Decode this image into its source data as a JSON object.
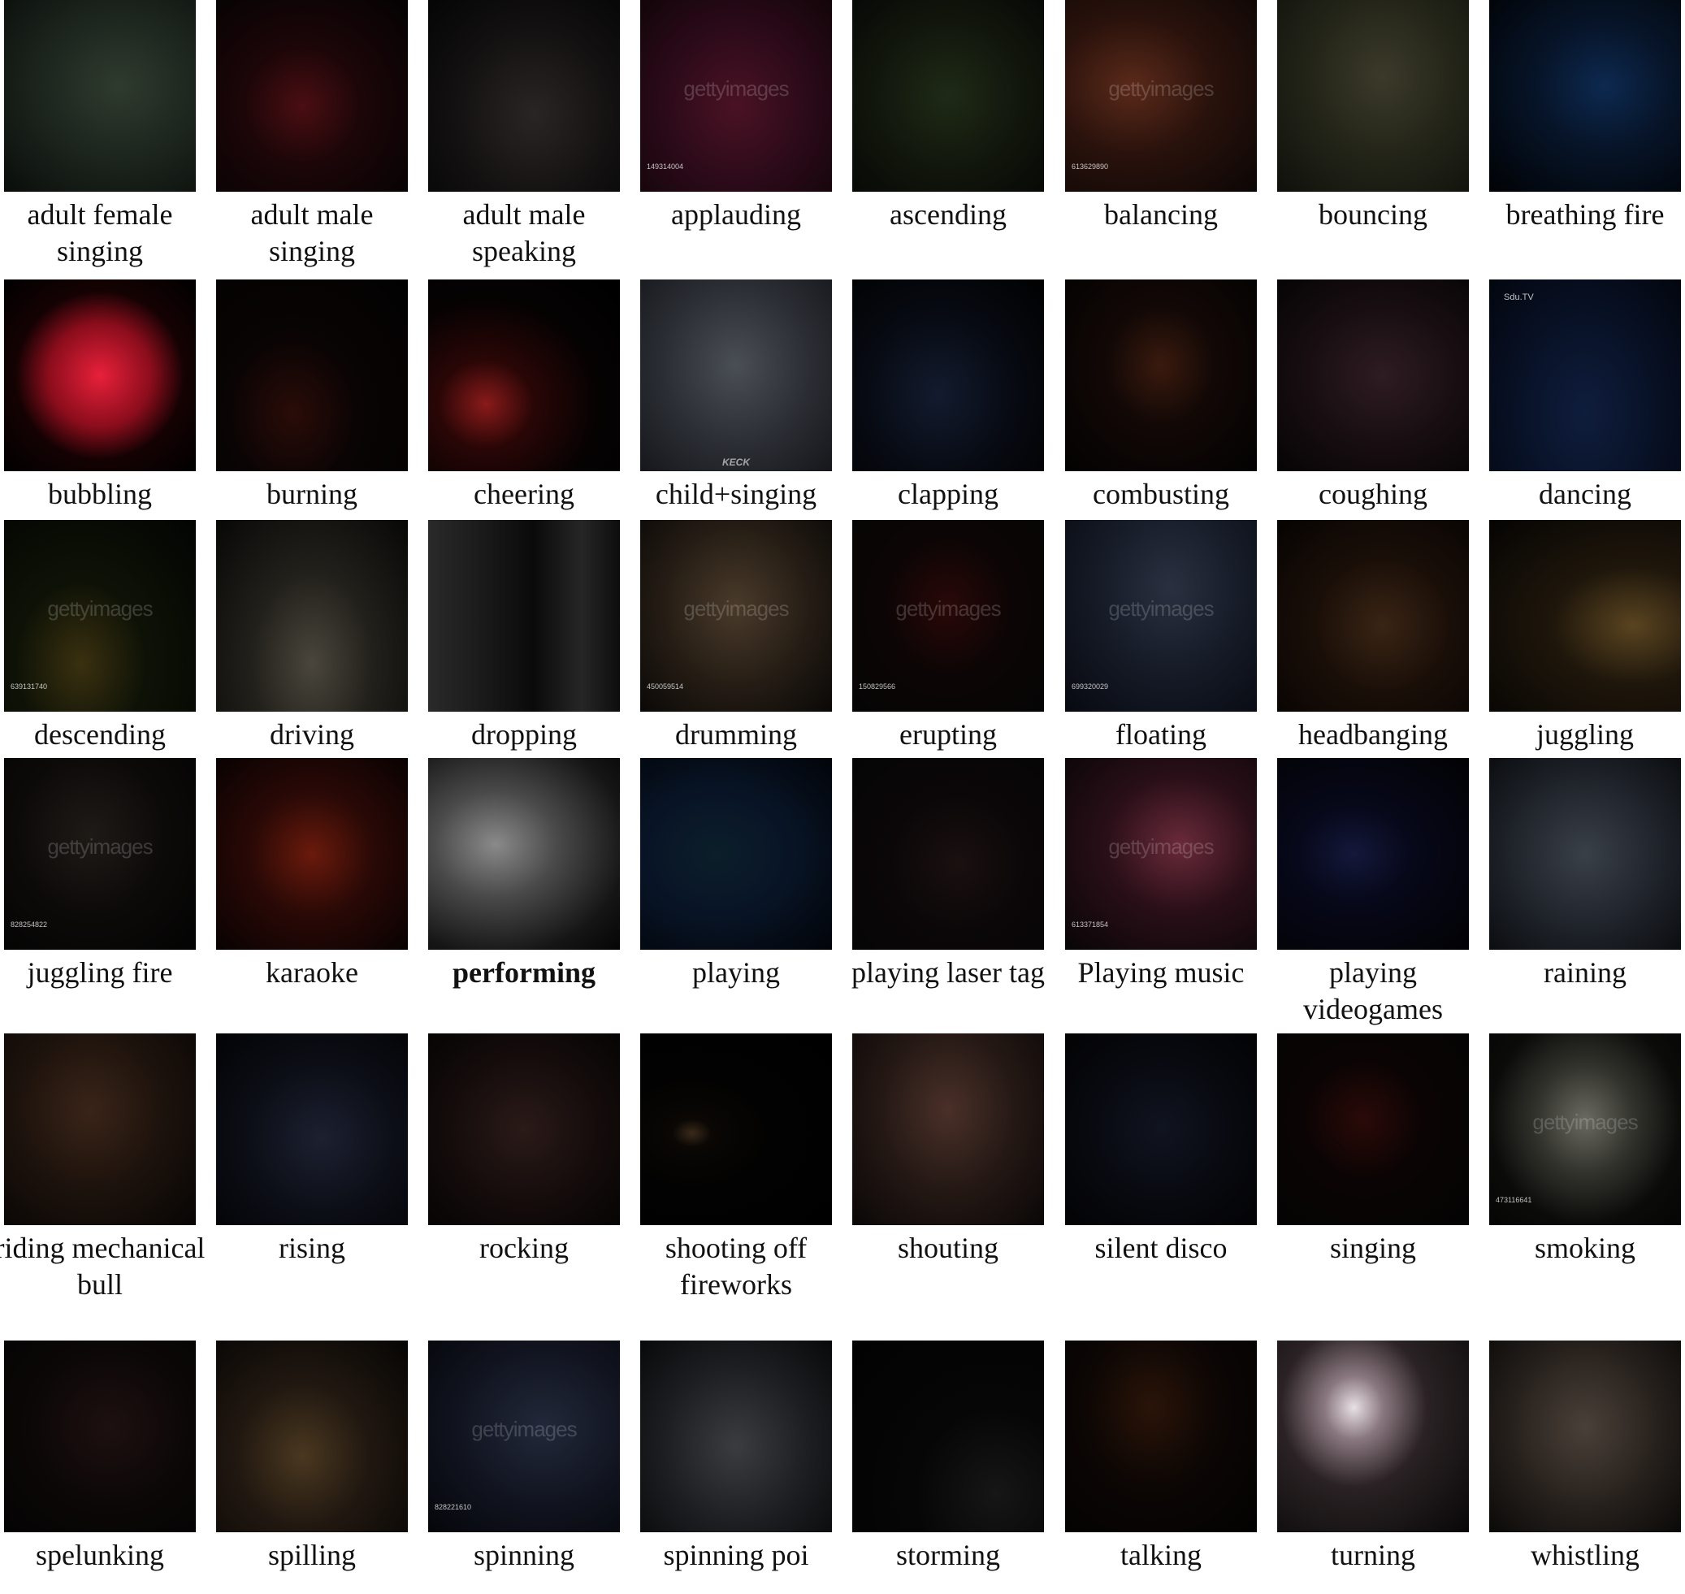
{
  "grid": {
    "cells": [
      {
        "label": "adult female singing",
        "bg": "radial-gradient(ellipse at 60% 45%, #2f3b2f 0%, #1a221b 55%, #0a0d0a 100%)"
      },
      {
        "label": "adult male singing",
        "bg": "radial-gradient(ellipse at 45% 55%, #4a0e12 0%, #1c0608 40%, #030203 100%)"
      },
      {
        "label": "adult male speaking",
        "bg": "radial-gradient(ellipse at 55% 60%, #2a2524 0%, #121010 55%, #050505 100%)"
      },
      {
        "label": "applauding",
        "bg": "radial-gradient(ellipse at 50% 55%, #4a1224 0%, #2a0a18 55%, #120509 100%)",
        "wm": "gettyimages",
        "idnum": "149314004"
      },
      {
        "label": "ascending",
        "bg": "radial-gradient(ellipse at 50% 50%, #1f2a16 0%, #11160c 55%, #070906 100%)"
      },
      {
        "label": "balancing",
        "bg": "radial-gradient(ellipse at 35% 45%, #5b2a1a 0%, #2a120c 45%, #0b0605 100%)",
        "wm": "gettyimages",
        "idnum": "613629890"
      },
      {
        "label": "bouncing",
        "bg": "radial-gradient(ellipse at 55% 40%, #3b3a2a 0%, #232418 50%, #0f100b 100%)"
      },
      {
        "label": "breathing fire",
        "bg": "radial-gradient(ellipse at 60% 45%, #0d2950 0%, #07152a 40%, #010204 100%)"
      },
      {
        "label": "bubbling",
        "bg": "radial-gradient(ellipse at 50% 50%, #e8203a 0%, #8b0d1c 38%, #150203 62%, #000 100%)"
      },
      {
        "label": "burning",
        "bg": "radial-gradient(ellipse at 40% 70%, #2a0c08 0%, #0a0404 40%, #010101 100%)"
      },
      {
        "label": "cheering",
        "bg": "radial-gradient(ellipse at 30% 65%, #8a1a1a 0%, #2a0606 25%, #050202 60%, #000 100%)"
      },
      {
        "label": "child+singing",
        "bg": "radial-gradient(ellipse at 50% 45%, #4a4e55 0%, #2a2d33 55%, #15171b 100%)",
        "brand": "KECK"
      },
      {
        "label": "clapping",
        "bg": "radial-gradient(ellipse at 45% 60%, #121b2e 0%, #070a12 50%, #010101 100%)"
      },
      {
        "label": "combusting",
        "bg": "radial-gradient(ellipse at 50% 45%, #3a1a0e 0%, #120806 40%, #020202 100%)"
      },
      {
        "label": "coughing",
        "bg": "radial-gradient(ellipse at 55% 50%, #2e1c22 0%, #160d10 55%, #060405 100%)"
      },
      {
        "label": "dancing",
        "bg": "radial-gradient(ellipse at 50% 70%, #0f1d3d 0%, #081126 50%, #03060e 100%)",
        "tag": "Sdu.TV"
      },
      {
        "label": "descending",
        "bg": "radial-gradient(ellipse at 40% 75%, #3a3010 0%, #0e1206 40%, #020402 100%)",
        "wm": "gettyimages",
        "idnum": "639131740"
      },
      {
        "label": "driving",
        "bg": "radial-gradient(ellipse at 50% 75%, #4a463c 0%, #22201b 45%, #070706 100%)"
      },
      {
        "label": "dropping",
        "bg": "linear-gradient(90deg, #2a2a2a 0%, #161616 35%, #0a0a0a 55%, #262626 80%, #0d0d0d 100%)"
      },
      {
        "label": "drumming",
        "bg": "radial-gradient(ellipse at 50% 45%, #4a3a2a 0%, #241c14 55%, #0a0807 100%)",
        "wm": "gettyimages",
        "idnum": "450059514"
      },
      {
        "label": "erupting",
        "bg": "radial-gradient(ellipse at 50% 45%, #2a0808 0%, #0d0505 45%, #050505 100%)",
        "wm": "gettyimages",
        "idnum": "150829566"
      },
      {
        "label": "floating",
        "bg": "radial-gradient(ellipse at 55% 35%, #2a3040 0%, #151a26 50%, #070910 100%)",
        "wm": "gettyimages",
        "idnum": "699320029"
      },
      {
        "label": "headbanging",
        "bg": "radial-gradient(ellipse at 55% 55%, #3a2414 0%, #1a0f08 45%, #060302 100%)"
      },
      {
        "label": "juggling",
        "bg": "radial-gradient(ellipse at 75% 55%, #5a4420 0%, #1e160b 40%, #050403 100%)"
      },
      {
        "label": "juggling fire",
        "bg": "radial-gradient(ellipse at 45% 40%, #1e1a16 0%, #0c0a09 50%, #030303 100%)",
        "wm": "gettyimages",
        "idnum": "828254822"
      },
      {
        "label": "karaoke",
        "bg": "radial-gradient(ellipse at 50% 50%, #6a1a0c 0%, #2a0906 45%, #080202 100%)"
      },
      {
        "label": "performing",
        "bold": true,
        "bg": "radial-gradient(ellipse at 35% 45%, #8a8a8a 0%, #4a4a4a 35%, #151515 75%, #050505 100%)"
      },
      {
        "label": "playing",
        "bg": "radial-gradient(ellipse at 40% 50%, #0c1e2a 0%, #081426 45%, #020408 100%)"
      },
      {
        "label": "playing laser tag",
        "bg": "radial-gradient(ellipse at 55% 55%, #1a1010 0%, #0b0708 45%, #050505 100%)"
      },
      {
        "label": "Playing music",
        "bg": "radial-gradient(ellipse at 60% 45%, #6a2a3a 0%, #2a0f18 45%, #070506 100%)",
        "wm": "gettyimages",
        "idnum": "613371854"
      },
      {
        "label": "playing videogames",
        "bg": "radial-gradient(ellipse at 40% 50%, #14183a 0%, #07081a 35%, #020203 100%)"
      },
      {
        "label": "raining",
        "bg": "radial-gradient(ellipse at 50% 50%, #3a4048 0%, #1f232a 55%, #0b0d10 100%)"
      },
      {
        "label": "riding mechanical bull",
        "bg": "radial-gradient(ellipse at 45% 40%, #3a2418 0%, #1c120c 50%, #070504 100%)"
      },
      {
        "label": "rising",
        "bg": "radial-gradient(ellipse at 55% 55%, #1c2030 0%, #0c0e16 50%, #030305 100%)"
      },
      {
        "label": "rocking",
        "bg": "radial-gradient(ellipse at 50% 50%, #2a1a18 0%, #140c0b 55%, #060404 100%)"
      },
      {
        "label": "shooting off fireworks",
        "bg": "radial-gradient(ellipse at 27% 52%, #3a2a1a 0%, #0a0704 10%, #020202 40%, #000 100%)"
      },
      {
        "label": "shouting",
        "bg": "radial-gradient(ellipse at 50% 40%, #4a3028 0%, #241814 50%, #0a0707 100%)"
      },
      {
        "label": "silent disco",
        "bg": "radial-gradient(ellipse at 50% 50%, #101420 0%, #08090f 55%, #030304 100%)"
      },
      {
        "label": "singing",
        "bg": "radial-gradient(ellipse at 45% 45%, #2a0a08 0%, #0b0404 40%, #030303 100%)"
      },
      {
        "label": "smoking",
        "bg": "radial-gradient(ellipse at 50% 45%, #6a6a62 0%, #34342e 35%, #0b0b0a 70%, #050505 100%)",
        "wm": "gettyimages",
        "idnum": "473116641"
      },
      {
        "label": "spelunking",
        "bg": "radial-gradient(ellipse at 55% 45%, #1e1010 0%, #0b0707 55%, #040303 100%)"
      },
      {
        "label": "spilling",
        "bg": "radial-gradient(ellipse at 45% 60%, #4a3820 0%, #201710 45%, #060504 100%)"
      },
      {
        "label": "spinning",
        "bg": "radial-gradient(ellipse at 60% 45%, #22283a 0%, #10131e 55%, #05060a 100%)",
        "wm": "gettyimages",
        "idnum": "828221610"
      },
      {
        "label": "spinning poi",
        "bg": "radial-gradient(ellipse at 50% 55%, #3a3c40 0%, #1c1d20 55%, #08090a 100%)"
      },
      {
        "label": "storming",
        "bg": "radial-gradient(ellipse at 75% 80%, #161616 0%, #060606 40%, #020202 100%)"
      },
      {
        "label": "talking",
        "bg": "radial-gradient(ellipse at 45% 35%, #2a1408 0%, #0c0604 45%, #020202 100%)"
      },
      {
        "label": "turning",
        "bg": "radial-gradient(ellipse at 40% 35%, #e8e0e4 0%, #8a7880 18%, #2a2224 45%, #080707 100%)"
      },
      {
        "label": "whistling",
        "bg": "radial-gradient(ellipse at 50% 45%, #4a4038 0%, #26201c 55%, #0a0908 100%)"
      }
    ]
  }
}
